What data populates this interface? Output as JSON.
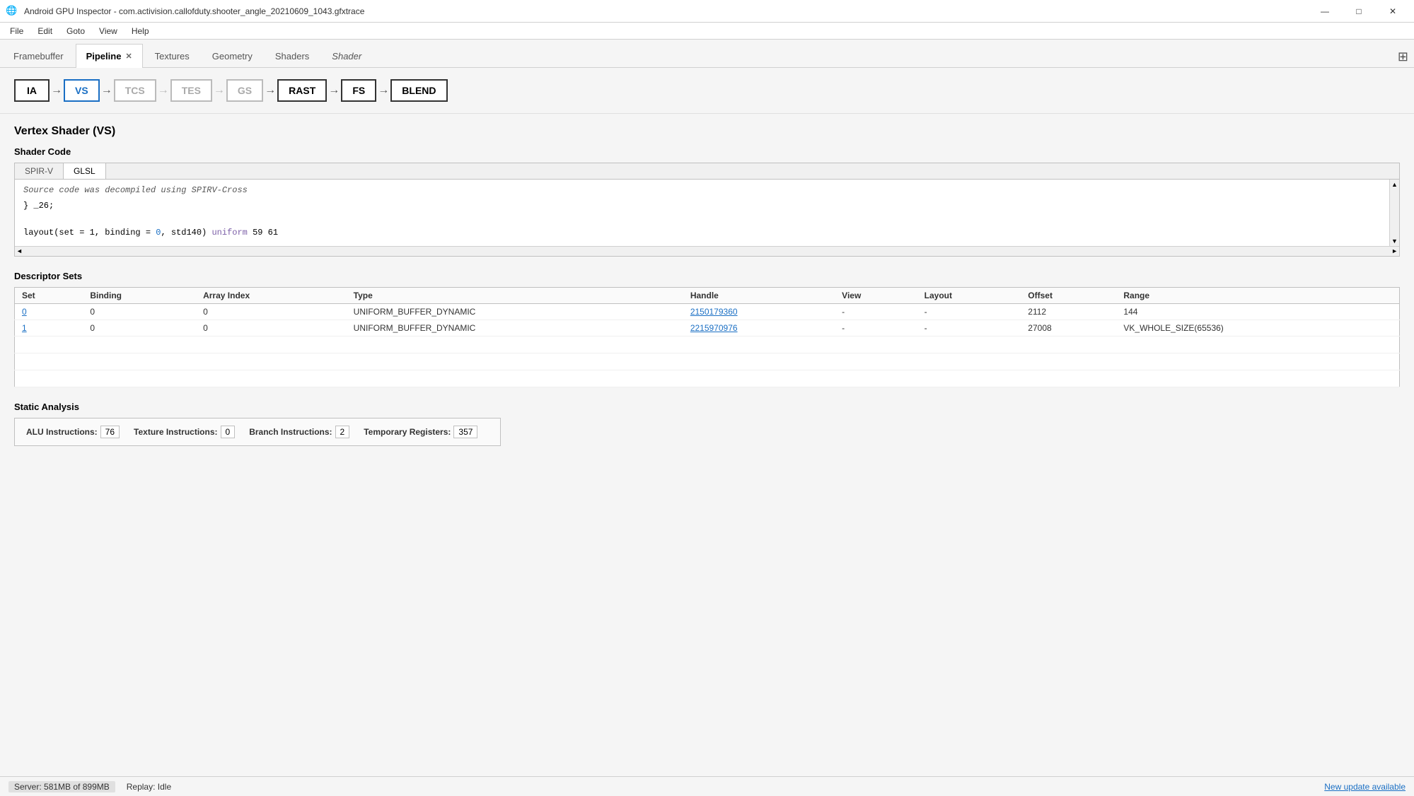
{
  "titleBar": {
    "icon": "🌐",
    "title": "Android GPU Inspector - com.activision.callofduty.shooter_angle_20210609_1043.gfxtrace",
    "minBtn": "—",
    "maxBtn": "□",
    "closeBtn": "✕"
  },
  "menuBar": {
    "items": [
      "File",
      "Edit",
      "Goto",
      "View",
      "Help"
    ]
  },
  "tabs": [
    {
      "id": "framebuffer",
      "label": "Framebuffer",
      "active": false,
      "closable": false,
      "italic": false
    },
    {
      "id": "pipeline",
      "label": "Pipeline",
      "active": true,
      "closable": true,
      "italic": false
    },
    {
      "id": "textures",
      "label": "Textures",
      "active": false,
      "closable": false,
      "italic": false
    },
    {
      "id": "geometry",
      "label": "Geometry",
      "active": false,
      "closable": false,
      "italic": false
    },
    {
      "id": "shaders",
      "label": "Shaders",
      "active": false,
      "closable": false,
      "italic": false
    },
    {
      "id": "shader-italic",
      "label": "Shader",
      "active": false,
      "closable": false,
      "italic": true
    }
  ],
  "gridIcon": "⊞",
  "pipeline": {
    "nodes": [
      {
        "id": "ia",
        "label": "IA",
        "active": false,
        "dim": false
      },
      {
        "id": "vs",
        "label": "VS",
        "active": true,
        "dim": false
      },
      {
        "id": "tcs",
        "label": "TCS",
        "active": false,
        "dim": true
      },
      {
        "id": "tes",
        "label": "TES",
        "active": false,
        "dim": true
      },
      {
        "id": "gs",
        "label": "GS",
        "active": false,
        "dim": true
      },
      {
        "id": "rast",
        "label": "RAST",
        "active": false,
        "dim": false
      },
      {
        "id": "fs",
        "label": "FS",
        "active": false,
        "dim": false
      },
      {
        "id": "blend",
        "label": "BLEND",
        "active": false,
        "dim": false
      }
    ]
  },
  "sectionTitle": "Vertex Shader (VS)",
  "shaderCode": {
    "sectionLabel": "Shader Code",
    "tabs": [
      {
        "id": "spirv",
        "label": "SPIR-V",
        "active": false
      },
      {
        "id": "glsl",
        "label": "GLSL",
        "active": true
      }
    ],
    "infoText": "Source code was decompiled using SPIRV-Cross",
    "lines": [
      {
        "text": "} _26;"
      },
      {
        "text": ""
      },
      {
        "prefix": "layout(set = 1, binding = ",
        "num1": "0",
        "middle": ", std140) ",
        "keyword": "uniform",
        "suffix": " 59 61"
      }
    ]
  },
  "descriptorSets": {
    "sectionLabel": "Descriptor Sets",
    "columns": [
      "Set",
      "Binding",
      "Array Index",
      "Type",
      "Handle",
      "View",
      "Layout",
      "Offset",
      "Range"
    ],
    "rows": [
      {
        "set": "0",
        "setLink": true,
        "binding": "0",
        "arrayIndex": "0",
        "type": "UNIFORM_BUFFER_DYNAMIC",
        "handle": "2150179360",
        "handleLink": true,
        "view": "-",
        "layout": "-",
        "offset": "2112",
        "range": "144"
      },
      {
        "set": "1",
        "setLink": true,
        "binding": "0",
        "arrayIndex": "0",
        "type": "UNIFORM_BUFFER_DYNAMIC",
        "handle": "2215970976",
        "handleLink": true,
        "view": "-",
        "layout": "-",
        "offset": "27008",
        "range": "VK_WHOLE_SIZE(65536)"
      }
    ]
  },
  "staticAnalysis": {
    "sectionLabel": "Static Analysis",
    "metrics": [
      {
        "label": "ALU Instructions:",
        "value": "76"
      },
      {
        "label": "Texture Instructions:",
        "value": "0"
      },
      {
        "label": "Branch Instructions:",
        "value": "2"
      },
      {
        "label": "Temporary Registers:",
        "value": "357"
      }
    ]
  },
  "statusBar": {
    "serverLabel": "Server:",
    "serverValue": "581MB of 899MB",
    "replayLabel": "Replay:",
    "replayValue": "Idle",
    "updateLink": "New update available"
  }
}
